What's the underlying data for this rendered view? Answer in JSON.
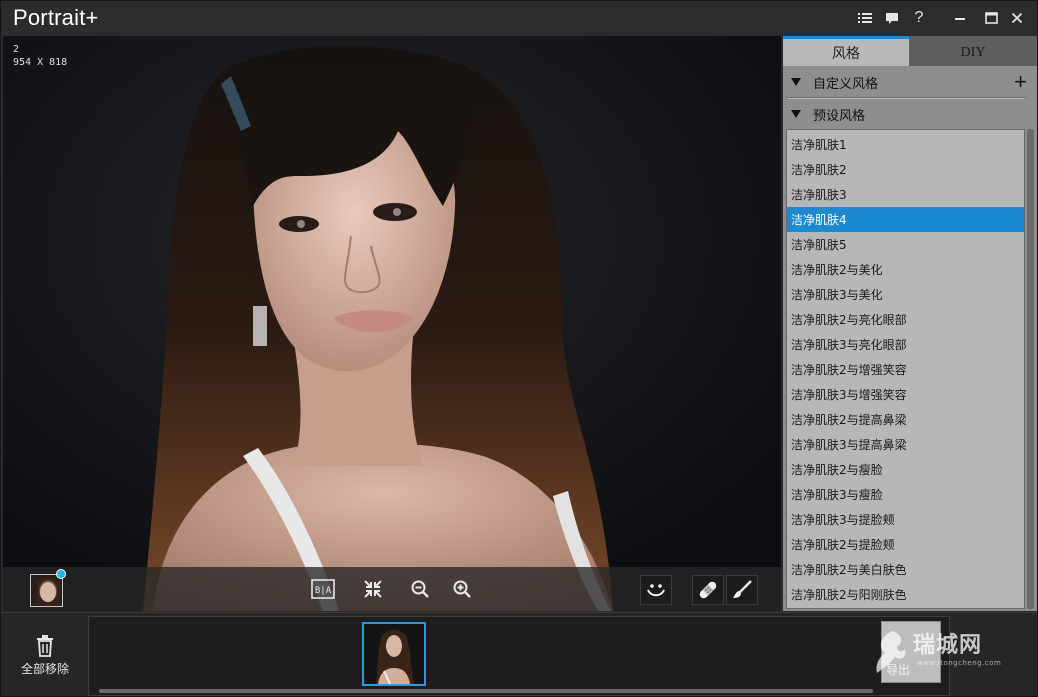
{
  "app": {
    "title": "Portrait+"
  },
  "titlebar": {
    "list_icon": "list-icon",
    "chat_icon": "chat-icon",
    "help_label": "?",
    "minimize_icon": "minimize-icon",
    "maximize_icon": "maximize-icon",
    "close_icon": "close-icon"
  },
  "image_info": {
    "index": "2",
    "dimensions": "954 X 818"
  },
  "viewer_toolbar": {
    "before_after_icon": "before-after-icon",
    "fit_icon": "fit-to-window-icon",
    "zoom_out_icon": "zoom-out-icon",
    "zoom_in_icon": "zoom-in-icon",
    "smile_icon": "smile-icon",
    "bandage_icon": "bandage-icon",
    "brush_icon": "brush-icon"
  },
  "right_panel": {
    "tabs": [
      {
        "label": "风格",
        "active": true
      },
      {
        "label": "DIY",
        "active": false
      }
    ],
    "custom_section": {
      "label": "自定义风格",
      "add_label": "+"
    },
    "preset_section": {
      "label": "预设风格"
    },
    "preset_items": [
      "洁净肌肤1",
      "洁净肌肤2",
      "洁净肌肤3",
      "洁净肌肤4",
      "洁净肌肤5",
      "洁净肌肤2与美化",
      "洁净肌肤3与美化",
      "洁净肌肤2与亮化眼部",
      "洁净肌肤3与亮化眼部",
      "洁净肌肤2与增强笑容",
      "洁净肌肤3与增强笑容",
      "洁净肌肤2与提高鼻梁",
      "洁净肌肤3与提高鼻梁",
      "洁净肌肤2与瘦脸",
      "洁净肌肤3与瘦脸",
      "洁净肌肤3与提脸颊",
      "洁净肌肤2与提脸颊",
      "洁净肌肤2与美白肤色",
      "洁净肌肤2与阳刚肤色"
    ],
    "selected_index": 3,
    "accent_color": "#1b8ad3"
  },
  "bottom": {
    "remove_all_label": "全部移除",
    "export_label": "导出",
    "watermark_text": "瑞城网",
    "watermark_url": "www.itongcheng.com"
  }
}
